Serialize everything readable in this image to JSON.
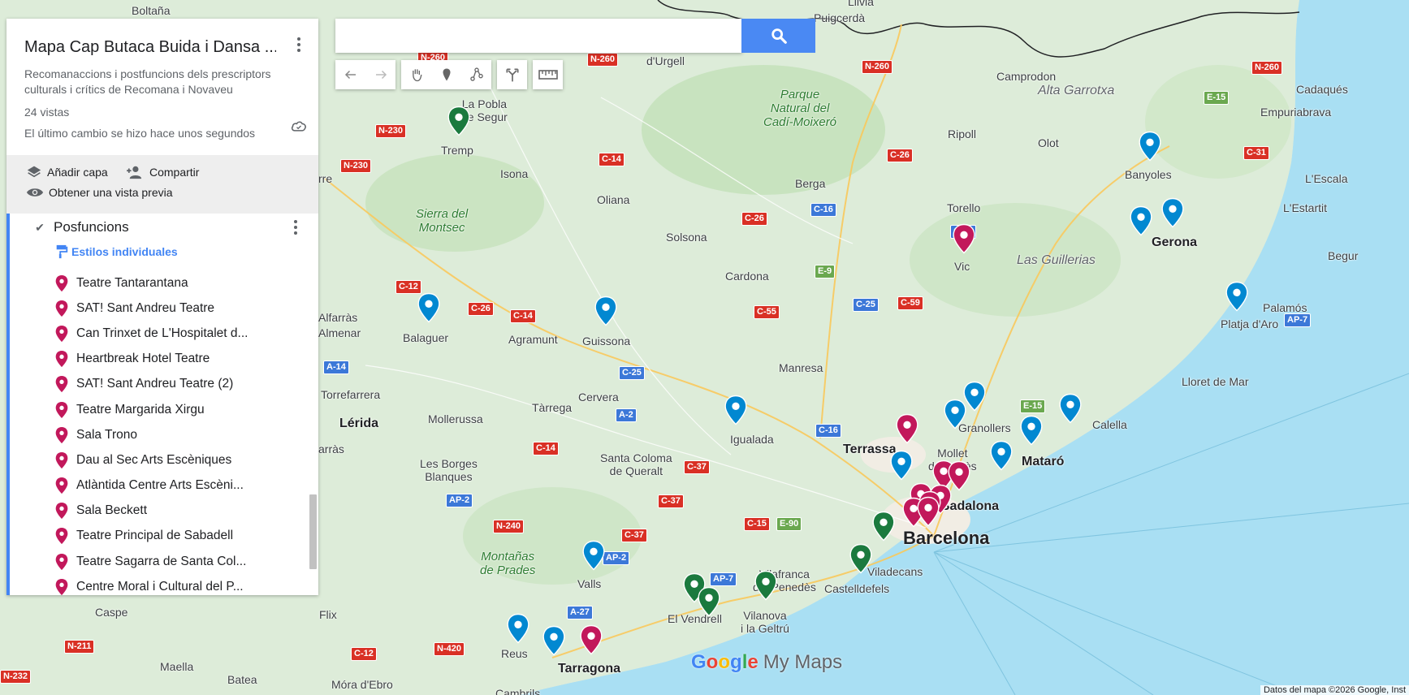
{
  "panel": {
    "title": "Mapa Cap Butaca Buida i Dansa ...",
    "description": "Recomanaccions i postfuncions dels prescriptors culturals i crítics de Recomana i Novaveu",
    "views": "24 vistas",
    "last_change": "El último cambio se hizo hace unos segundos",
    "add_layer": "Añadir capa",
    "share": "Compartir",
    "preview": "Obtener una vista previa",
    "layer": {
      "name": "Posfuncions",
      "styles_label": "Estilos individuales",
      "items": [
        "Teatre Tantarantana",
        "SAT! Sant Andreu Teatre",
        "Can Trinxet de L'Hospitalet d...",
        "Heartbreak Hotel Teatre",
        "SAT! Sant Andreu Teatre (2)",
        "Teatre Margarida Xirgu",
        "Sala Trono",
        "Dau al Sec Arts Escèniques",
        "Atlàntida Centre Arts Escèni...",
        "Sala Beckett",
        "Teatre Principal de Sabadell",
        "Teatre Sagarra de Santa Col...",
        "Centre Moral i Cultural del P..."
      ]
    }
  },
  "search": {
    "placeholder": "",
    "value": ""
  },
  "toolbar": [
    "undo-icon",
    "redo-icon",
    "hand-icon",
    "marker-icon",
    "draw-line-icon",
    "directions-icon",
    "ruler-icon"
  ],
  "colors": {
    "pin_magenta": "#c2185b",
    "pin_blue": "#0288d1",
    "pin_green": "#1b7a3e",
    "accent": "#4285f4"
  },
  "map": {
    "places": {
      "boltana": "Boltaña",
      "llivia": "Llivia",
      "puigcerda": "Puigcerdà",
      "durgell": "d'Urgell",
      "camprodon": "Camprodon",
      "cadaques": "Cadaqués",
      "alta_garrotxa": "Alta Garrotxa",
      "la_pobla": "La Pobla\nde Segur",
      "tremp": "Tremp",
      "isona": "Isona",
      "parc": "Parque\nNatural del\nCadí-Moixeró",
      "ripoll": "Ripoll",
      "olot": "Olot",
      "empuriabrava": "Empuriabrava",
      "banyoles": "Banyoles",
      "lescala": "L'Escala",
      "lestartit": "L'Estartit",
      "oliana": "Oliana",
      "berga": "Berga",
      "sierra_montsec": "Sierra del\nMontsec",
      "torello": "Torello",
      "rre": "rre",
      "solsona": "Solsona",
      "gerona": "Gerona",
      "vic": "Vic",
      "las_guillerias": "Las Guillerias",
      "begur": "Begur",
      "cardona": "Cardona",
      "palamos": "Palamós",
      "alfarras": "Alfarràs",
      "almenar": "Almenar",
      "balaguer": "Balaguer",
      "agramunt": "Agramunt",
      "guissona": "Guissona",
      "platja": "Platja d'Aro",
      "manresa": "Manresa",
      "torrefarrera": "Torrefarrera",
      "lloret": "Lloret de Mar",
      "cervera": "Cervera",
      "lerida": "Lérida",
      "mollerussa": "Mollerussa",
      "tarrega": "Tàrrega",
      "igualada": "Igualada",
      "granollers": "Granollers",
      "calella": "Calella",
      "terrassa": "Terrassa",
      "mollet": "Mollet\ndel Vallès",
      "mataro": "Mataró",
      "arras": "arràs",
      "borges": "Les Borges\nBlanques",
      "santa_coloma": "Santa Coloma\nde Queralt",
      "badalona": "Badalona",
      "barcelona": "Barcelona",
      "vilafranca": "Vilafranca\ndel Penedès",
      "montanas": "Montañas\nde Prades",
      "viladecans": "Viladecans",
      "castelldefels": "Castelldefels",
      "valls": "Valls",
      "caspe": "Caspe",
      "flix": "Flix",
      "el_vendrell": "El Vendrell",
      "vilanova": "Vilanova\ni la Geltrú",
      "maella": "Maella",
      "batea": "Batea",
      "reus": "Reus",
      "tarragona": "Tarragona",
      "mora": "Móra d'Ebro",
      "cambrils": "Cambrils"
    },
    "roads": [
      "N-260",
      "N-260",
      "N-260",
      "N-260",
      "N-230",
      "N-230",
      "C-14",
      "C-26",
      "C-16",
      "C-26",
      "C-17",
      "E-9",
      "C-12",
      "C-26",
      "C-14",
      "C-55",
      "C-25",
      "C-59",
      "E-15",
      "C-31",
      "A-14",
      "C-25",
      "A-2",
      "E-15",
      "C-16",
      "C-14",
      "C-37",
      "AP-2",
      "C-37",
      "N-240",
      "C-37",
      "AP-2",
      "C-15",
      "E-90",
      "AP-7",
      "A-27",
      "N-211",
      "N-420",
      "C-12",
      "N-232",
      "AP-7"
    ],
    "logo": {
      "g": "G",
      "o1": "o",
      "o2": "o",
      "g2": "g",
      "l": "l",
      "e": "e",
      "my_maps": "My Maps"
    },
    "attribution": "Datos del mapa ©2026 Google, Inst"
  }
}
